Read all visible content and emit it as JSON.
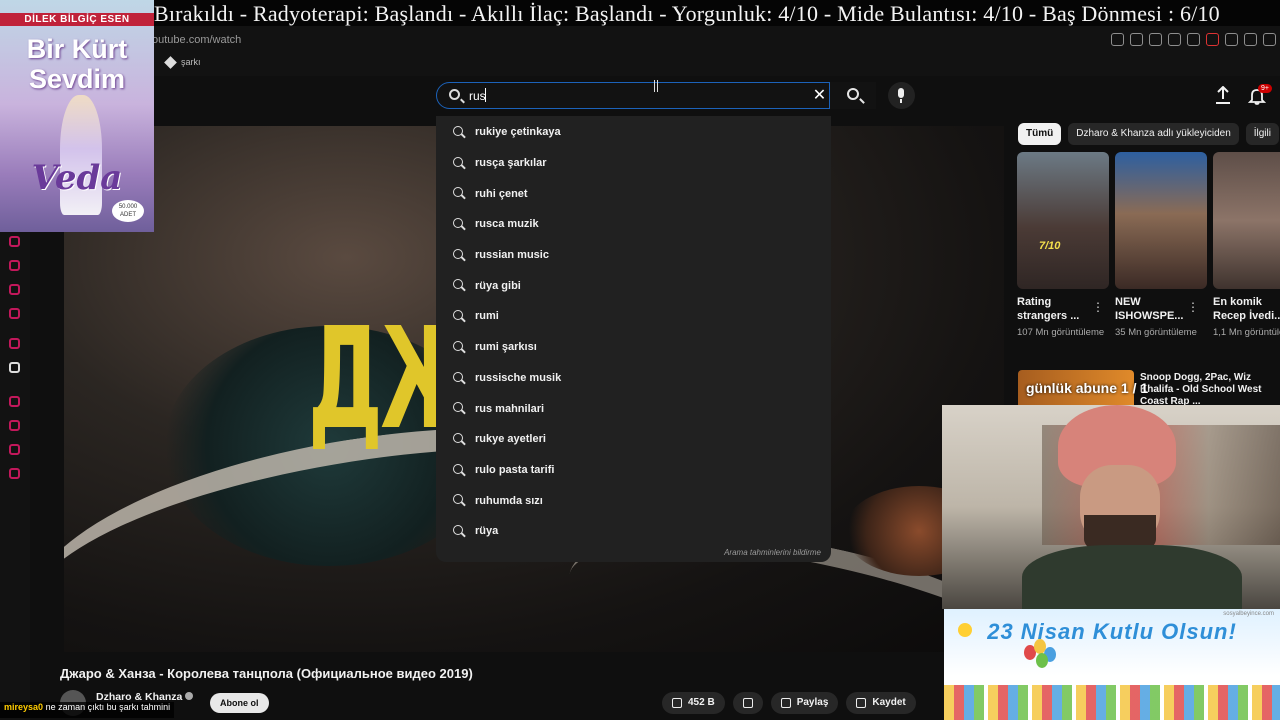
{
  "ticker": {
    "text": "Bırakıldı - Radyoterapi: Başlandı - Akıllı İlaç: Başlandı - Yorgunluk: 4/10 - Mide Bulantısı: 4/10 - Baş Dönmesi : 6/10"
  },
  "browser": {
    "url": "outube.com/watch",
    "bookmark_label": "şarkı"
  },
  "search": {
    "value": "rus",
    "clear_label": "✕",
    "suggestions": [
      "rukiye çetinkaya",
      "rusça şarkılar",
      "ruhi çenet",
      "rusca muzik",
      "russian music",
      "rüya gibi",
      "rumi",
      "rumi şarkısı",
      "russische musik",
      "rus mahnilari",
      "rukye ayetleri",
      "rulo pasta tarifi",
      "ruhumda sızı",
      "rüya"
    ],
    "report_label": "Arama tahminlerini bildirme"
  },
  "header": {
    "notification_badge": "9+"
  },
  "video": {
    "art_text": "ДЖА",
    "title": "Джаро & Ханза - Королева танцпола (Официальное видео 2019)"
  },
  "channel": {
    "name": "Dzharo & Khanza",
    "subscribe_label": "Abone ol"
  },
  "actions": {
    "likes": "452 B",
    "share": "Paylaş",
    "save": "Kaydet"
  },
  "chips": [
    "Tümü",
    "Dzharo & Khanza adlı yükleyiciden",
    "İlgili"
  ],
  "shorts": [
    {
      "title": "Rating strangers ...",
      "views": "107 Mn görüntüleme",
      "badge": "7/10"
    },
    {
      "title": "NEW ISHOWSPE...",
      "views": "35 Mn görüntüleme"
    },
    {
      "title": "En komik Recep İvedi...",
      "views": "1,1 Mn görüntüleme"
    }
  ],
  "recommendation": {
    "title": "Snoop Dogg, 2Pac, Wiz Khalifa - Old School West Coast Rap ..."
  },
  "overlay": {
    "gunluk": "günlük abune 1 / 1",
    "chat_user": "mireysa0",
    "chat_text": "ne zaman çıktı bu şarkı tahmini",
    "book_author": "DİLEK BİLGİÇ ESEN",
    "book_title": "Bir Kürt Sevdim",
    "book_subtitle": "Veda",
    "book_seal": "50.000 ADET",
    "banner_text": "23 Nisan Kutlu Olsun!",
    "banner_site": "sosyalbeyince.com"
  },
  "colors": {
    "search_border": "#1c62b9",
    "title_art": "#e0c62a",
    "notification": "#cc0000",
    "banner_text": "#2f8fd8"
  }
}
